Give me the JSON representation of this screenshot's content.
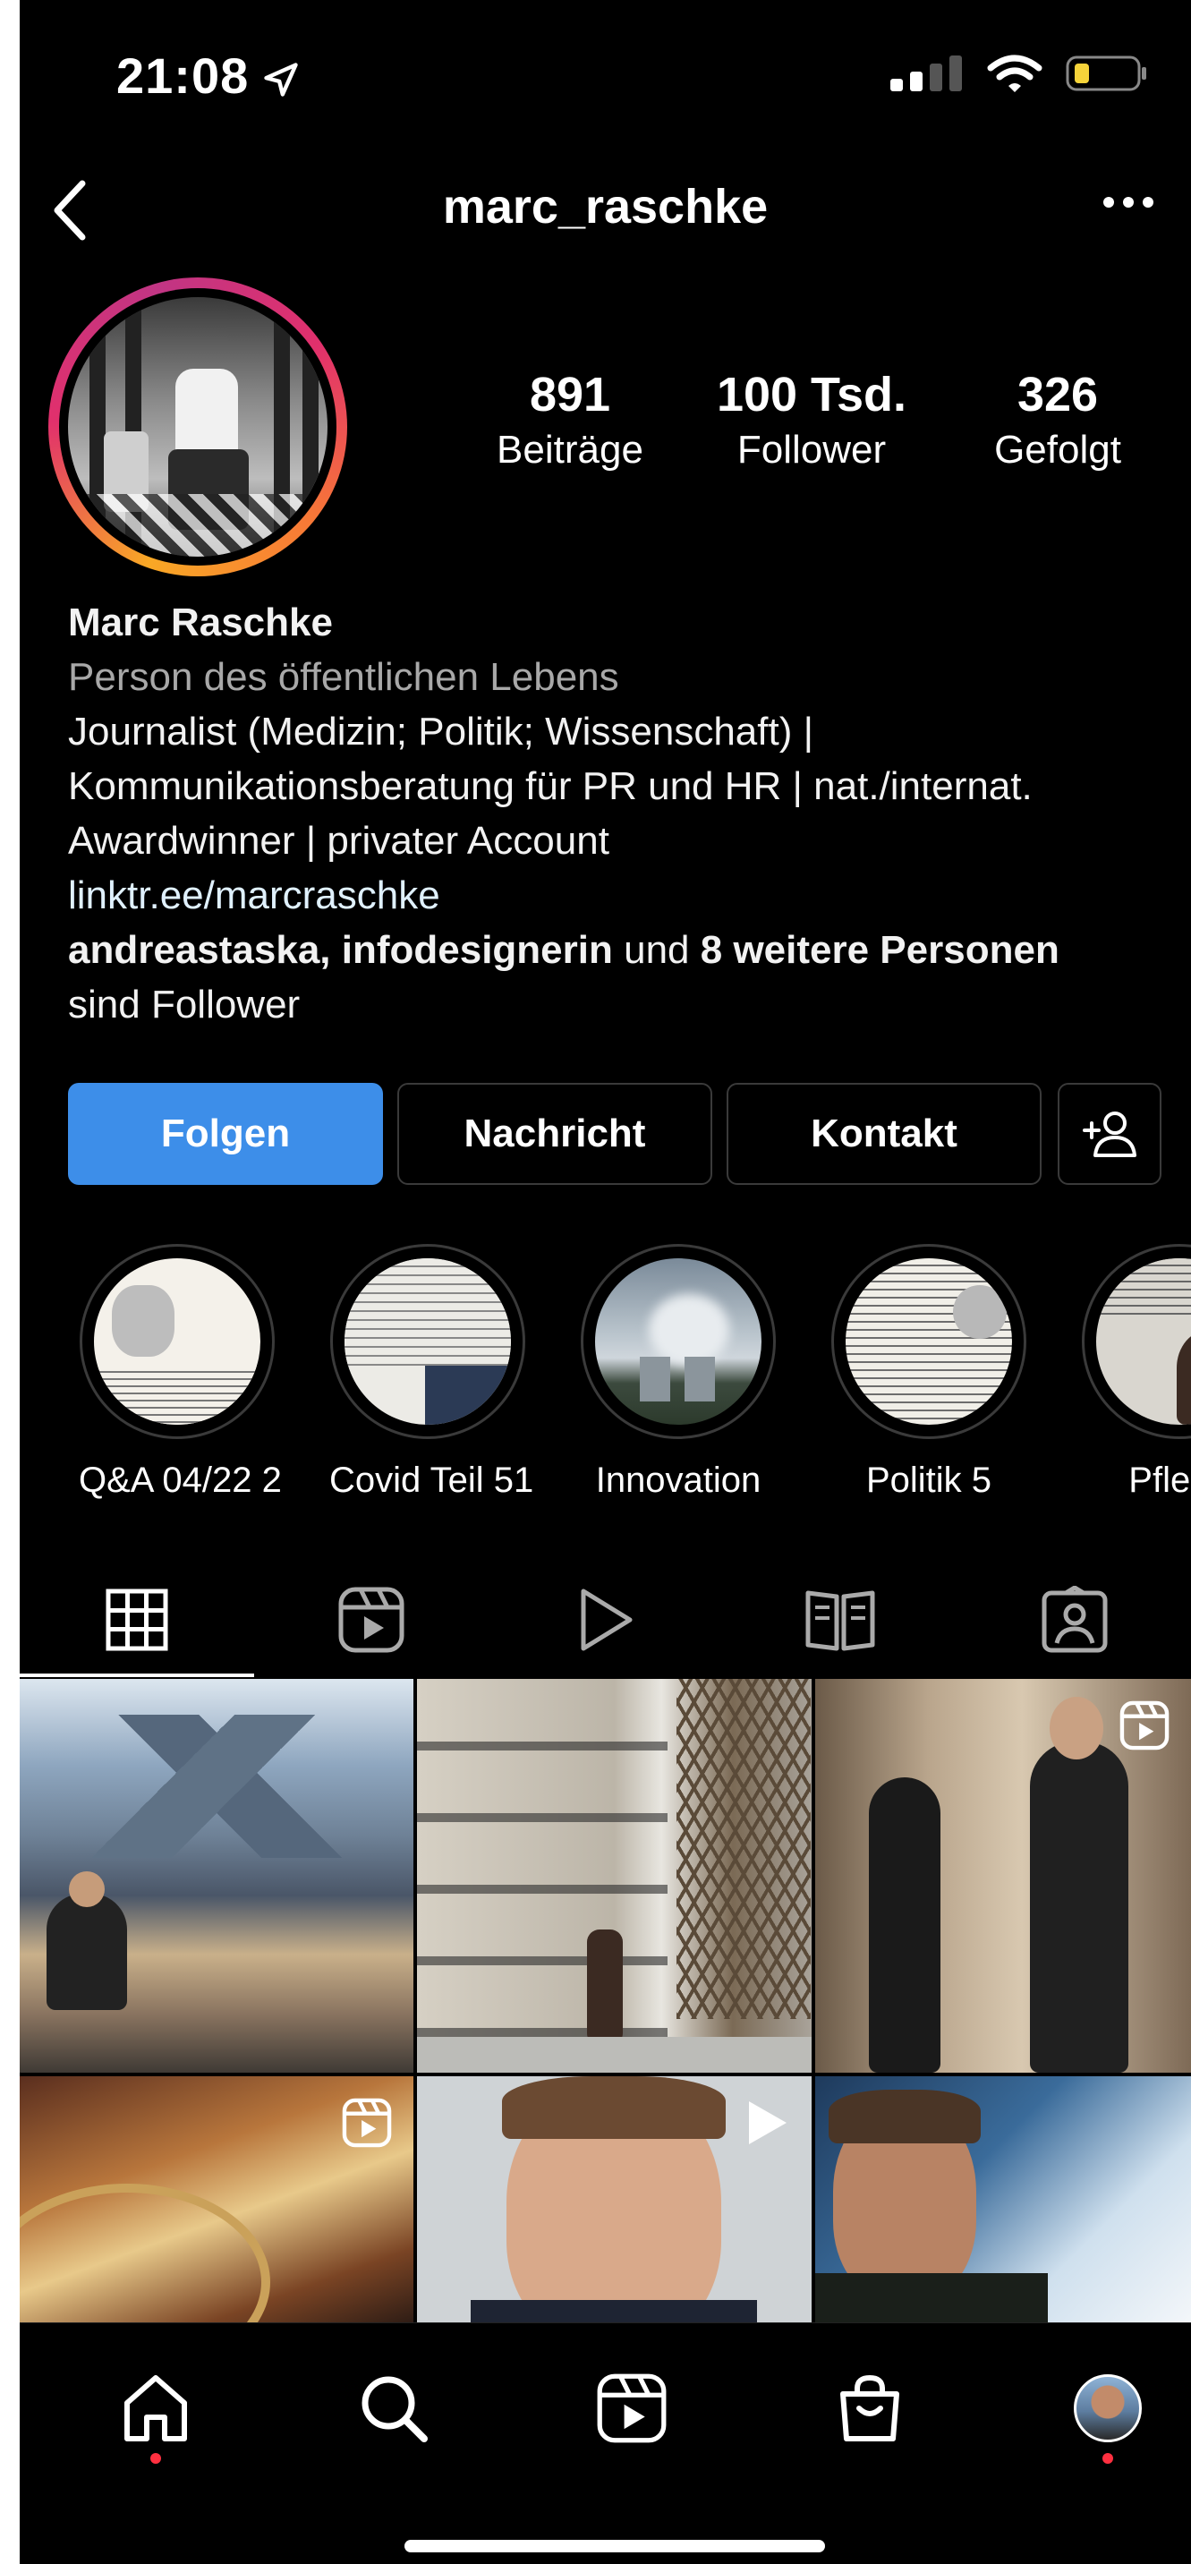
{
  "status": {
    "time": "21:08"
  },
  "header": {
    "username": "marc_raschke"
  },
  "stats": [
    {
      "value": "891",
      "label": "Beiträge"
    },
    {
      "value": "100 Tsd.",
      "label": "Follower"
    },
    {
      "value": "326",
      "label": "Gefolgt"
    }
  ],
  "bio": {
    "name": "Marc Raschke",
    "category": "Person des öffentlichen Lebens",
    "line1": "Journalist (Medizin; Politik; Wissenschaft) |",
    "line2": "Kommunikationsberatung für PR und HR | nat./internat.",
    "line3": "Awardwinner | privater Account",
    "link": "linktr.ee/marcraschke",
    "followed_by_names": "andreastaska, infodesignerin",
    "followed_by_and": " und ",
    "followed_by_more": "8 weitere Personen",
    "followed_by_suffix": "sind Follower"
  },
  "buttons": {
    "follow": "Folgen",
    "message": "Nachricht",
    "contact": "Kontakt"
  },
  "highlights": [
    {
      "label": "Q&A 04/22 2"
    },
    {
      "label": "Covid Teil 51"
    },
    {
      "label": "Innovation"
    },
    {
      "label": "Politik 5"
    },
    {
      "label": "Pflege"
    }
  ],
  "tabs": [
    "grid-icon",
    "reels-icon",
    "video-icon",
    "guide-icon",
    "tagged-icon"
  ],
  "nav": [
    "home-icon",
    "search-icon",
    "reels-icon",
    "shop-icon",
    "profile-avatar"
  ],
  "colors": {
    "primary_button": "#3d8ee9",
    "background": "#000000",
    "secondary_text": "#a8a8a8",
    "notification_dot": "#ff3040"
  }
}
